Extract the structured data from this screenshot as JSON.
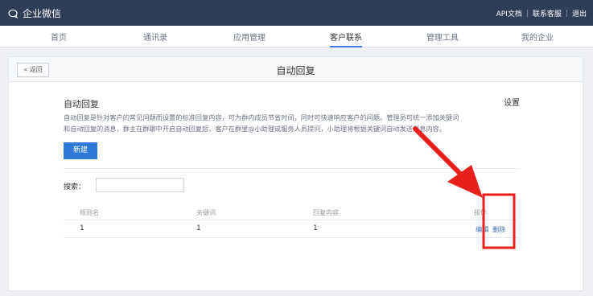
{
  "topbar": {
    "brand": "企业微信",
    "links": [
      "API文档",
      "联系客服",
      "退出"
    ]
  },
  "nav": {
    "items": [
      "首页",
      "通讯录",
      "应用管理",
      "客户联系",
      "管理工具",
      "我的企业"
    ],
    "active_index": 3
  },
  "panel": {
    "back_label": "« 返回",
    "title": "自动回复"
  },
  "section": {
    "title": "自动回复",
    "settings_label": "设置",
    "description_line1": "自动回复是针对客户的常见问题而设置的标准回复内容，可为群内成员节省时间，同时可快速响应客户的问题。管理员可统一添加关键词",
    "description_line2": "和自动回复的消息，群主在群聊中开启自动回复后，客户在群里@小助理或服务人员提问，小助理将根据关键词自动发送消息内容。",
    "new_button": "新建"
  },
  "search": {
    "label": "搜索：",
    "value": ""
  },
  "table": {
    "headers": [
      "规则名",
      "关键词",
      "回复内容",
      "操作"
    ],
    "rows": [
      {
        "rule": "1",
        "keyword": "1",
        "reply": "1",
        "edit": "编辑",
        "delete": "删除"
      }
    ]
  },
  "colors": {
    "topbar": "#2f3e57",
    "accent": "#2f7ad8",
    "annotation": "#e8201b"
  }
}
